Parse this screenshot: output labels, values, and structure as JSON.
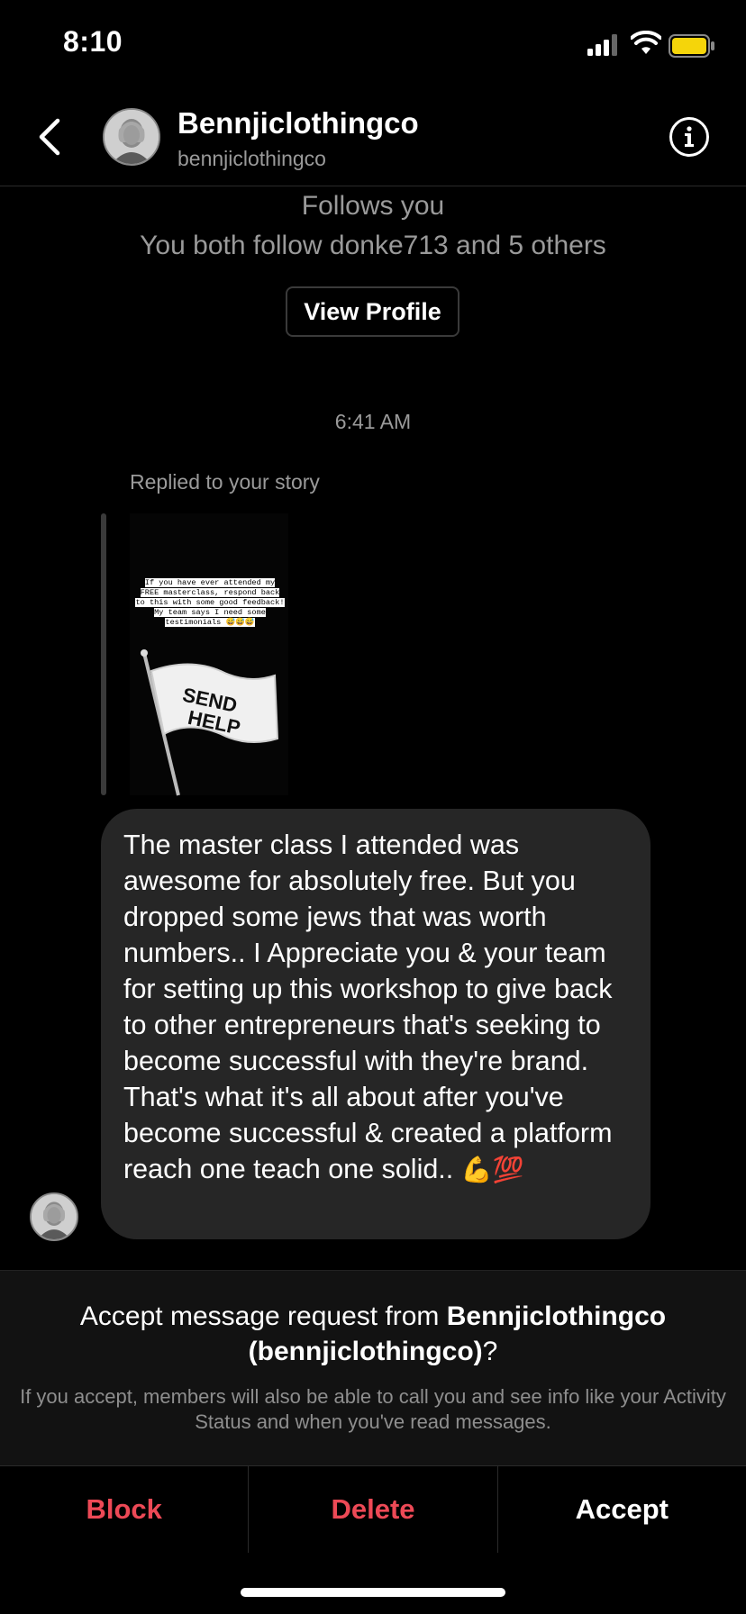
{
  "status_bar": {
    "time": "8:10"
  },
  "header": {
    "display_name": "Bennjiclothingco",
    "username": "bennjiclothingco"
  },
  "profile_info": {
    "follows": "Follows you",
    "mutual": "You both follow donke713 and 5 others",
    "view_profile_label": "View Profile"
  },
  "thread": {
    "timestamp": "6:41 AM",
    "story_reply_label": "Replied to your story",
    "story": {
      "caption": "If you have ever attended my FREE masterclass, respond back to this with some good feedback! My team says I need some testimonials 😅😅😅",
      "flag_text_1": "SEND",
      "flag_text_2": "HELP"
    },
    "message": {
      "text": "The master class I attended was awesome for absolutely free. But you dropped some jews that was worth numbers.. I Appreciate you & your team for setting up this workshop to give back to other entrepreneurs that's seeking to become successful with they're brand. That's what it's all about after you've become successful & created a platform reach one teach one solid..",
      "emojis": "💪💯"
    }
  },
  "request": {
    "title_prefix": "Accept message request from ",
    "title_name": "Bennjiclothingco (bennjiclothingco)",
    "title_suffix": "?",
    "subtitle": "If you accept, members will also be able to call you and see info like your Activity Status and when you've read messages.",
    "block_label": "Block",
    "delete_label": "Delete",
    "accept_label": "Accept"
  },
  "colors": {
    "background": "#000000",
    "bubble": "#262626",
    "destructive": "#ed4956",
    "battery": "#f5d50a"
  }
}
